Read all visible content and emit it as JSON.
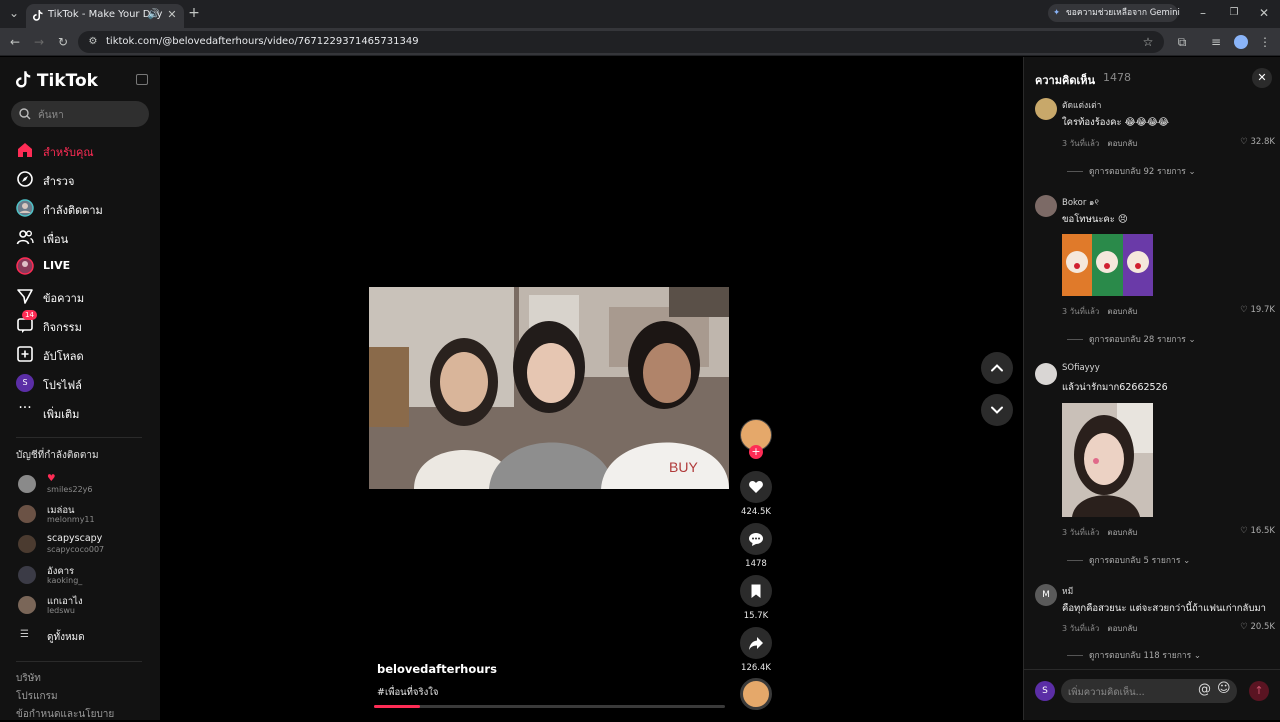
{
  "browser": {
    "tab_title": "TikTok - Make Your Day",
    "url": "tiktok.com/@belovedafterhours/video/7671229371465731349",
    "gemini_label": "ขอความช่วยเหลือจาก Gemini"
  },
  "sidebar": {
    "logo": "TikTok",
    "search_placeholder": "ค้นหา",
    "nav": [
      {
        "label": "สำหรับคุณ",
        "icon": "home-icon",
        "active": true
      },
      {
        "label": "สำรวจ",
        "icon": "compass-icon"
      },
      {
        "label": "กำลังติดตาม",
        "icon": "following-avatar-icon"
      },
      {
        "label": "เพื่อน",
        "icon": "friends-icon"
      },
      {
        "label": "LIVE",
        "icon": "live-icon"
      },
      {
        "label": "ข้อความ",
        "icon": "message-icon"
      },
      {
        "label": "กิจกรรม",
        "icon": "activity-icon",
        "badge": "14"
      },
      {
        "label": "อัปโหลด",
        "icon": "upload-icon"
      },
      {
        "label": "โปรไฟล์",
        "icon": "profile-icon",
        "avatar_letter": "S"
      },
      {
        "label": "เพิ่มเติม",
        "icon": "more-icon"
      }
    ],
    "following_heading": "บัญชีที่กำลังติดตาม",
    "following": [
      {
        "name": "",
        "username": "smiles22y6",
        "color": "#8a8a8a"
      },
      {
        "name": "เมล่อน",
        "username": "melonmy11",
        "color": "#6b5245"
      },
      {
        "name": "scapyscapy",
        "username": "scapycoco007",
        "color": "#4b3b30"
      },
      {
        "name": "อังคาร",
        "username": "kaoking_",
        "color": "#3b3b46"
      },
      {
        "name": "แกเอาไง",
        "username": "ledswu",
        "color": "#7a6658"
      }
    ],
    "see_all": "ดูทั้งหมด",
    "footer": [
      "บริษัท",
      "โปรแกรม",
      "ข้อกำหนดและนโยบาย"
    ]
  },
  "video": {
    "author": "belovedafterhours",
    "caption": "#เพื่อนที่จริงใจ",
    "progress": 0.13
  },
  "actions": [
    {
      "name": "like",
      "count": "424.5K"
    },
    {
      "name": "comment",
      "count": "1478"
    },
    {
      "name": "bookmark",
      "count": "15.7K"
    },
    {
      "name": "share",
      "count": "126.4K"
    }
  ],
  "comments_panel": {
    "title": "ความคิดเห็น",
    "count": "1478",
    "input_placeholder": "เพิ่มความคิดเห็น...",
    "self_avatar_letter": "S",
    "comments": [
      {
        "user": "ตัดแต่งเต่า",
        "text": "ใครท้องร้องคะ 😂😂😂😂",
        "time": "3 วันที่แล้ว",
        "reply": "ตอบกลับ",
        "likes": "32.8K",
        "view_replies": "ดูการตอบกลับ 92 รายการ",
        "avatar_color": "#c8a86a"
      },
      {
        "user": "Bokor ๑୧",
        "text": "ขอโทษนะคะ 😣",
        "time": "3 วันที่แล้ว",
        "reply": "ตอบกลับ",
        "likes": "19.7K",
        "view_replies": "ดูการตอบกลับ 28 รายการ",
        "avatar_color": "#7c6a66"
      },
      {
        "user": "SOfiayyy",
        "text": "แล้วน่ารักมาก62662526",
        "time": "3 วันที่แล้ว",
        "reply": "ตอบกลับ",
        "likes": "16.5K",
        "view_replies": "ดูการตอบกลับ 5 รายการ",
        "avatar_color": "#d9d6d4"
      },
      {
        "user": "หมี",
        "avatar_letter": "M",
        "text": "คือทุกคือสวยนะ แต่จะสวยกว่านี้ถ้าแฟนเก่ากลับมา",
        "time": "3 วันที่แล้ว",
        "reply": "ตอบกลับ",
        "likes": "20.5K",
        "view_replies": "ดูการตอบกลับ 118 รายการ",
        "avatar_color": "#5a5a5a"
      }
    ]
  },
  "colors": {
    "accent": "#fe2c55",
    "background": "#000000",
    "panel": "#121212"
  }
}
